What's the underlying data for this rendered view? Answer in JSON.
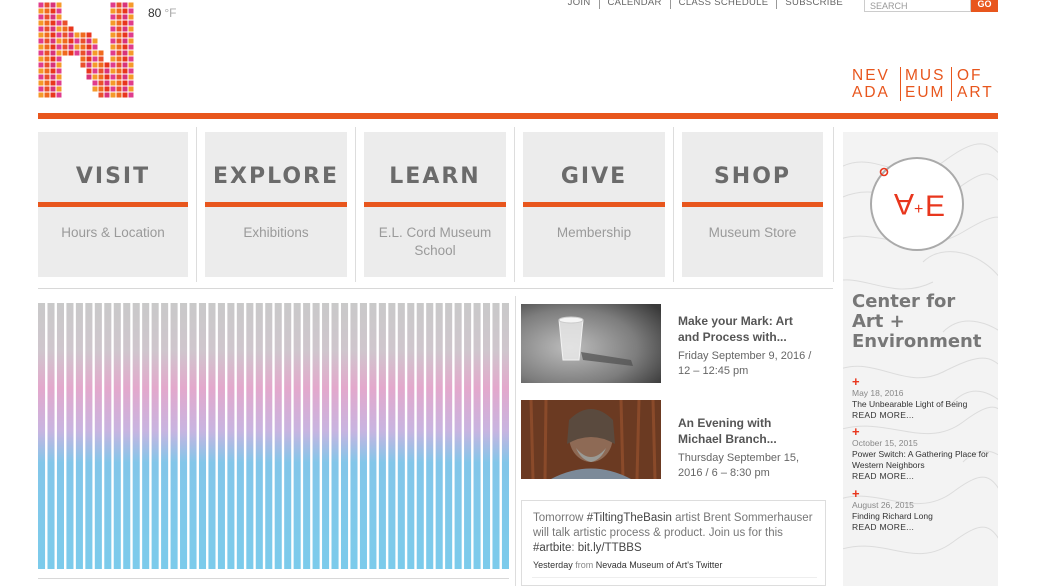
{
  "weather": {
    "temp": "80",
    "unit": "°F"
  },
  "top_nav": [
    "JOIN",
    "CALENDAR",
    "CLASS SCHEDULE",
    "SUBSCRIBE"
  ],
  "search": {
    "placeholder": "SEARCH",
    "button": "GO"
  },
  "wordmark": {
    "row1": [
      "NEV",
      "MUS",
      "OF"
    ],
    "row2": [
      "ADA",
      "EUM",
      "ART"
    ]
  },
  "tiles": [
    {
      "title": "VISIT",
      "subtitle": "Hours & Location"
    },
    {
      "title": "EXPLORE",
      "subtitle": "Exhibitions"
    },
    {
      "title": "LEARN",
      "subtitle": "E.L. Cord Museum School"
    },
    {
      "title": "GIVE",
      "subtitle": "Membership"
    },
    {
      "title": "SHOP",
      "subtitle": "Museum Store"
    }
  ],
  "events": [
    {
      "title": "Make your Mark: Art and Process with...",
      "date": "Friday September 9, 2016 / 12 – 12:45 pm"
    },
    {
      "title": "An Evening with Michael Branch...",
      "date": "Thursday September 15, 2016 / 6 – 8:30 pm"
    }
  ],
  "tweet": {
    "parts": [
      "Tomorrow ",
      "#TiltingTheBasin",
      " artist Brent Sommerhauser will talk artistic process & product. Join us for this ",
      "#artbite",
      ": ",
      "bit.ly/TTBBS"
    ],
    "when": "Yesterday",
    "from": "from",
    "account": "Nevada Museum of Art's Twitter"
  },
  "ae": {
    "logo_letters": [
      "A",
      "+",
      "E"
    ],
    "title": "Center for Art + Environment",
    "items": [
      {
        "date": "May 18, 2016",
        "title": "The Unbearable Light of Being",
        "more": "READ MORE..."
      },
      {
        "date": "October 15, 2015",
        "title": "Power Switch: A Gathering Place for Western Neighbors",
        "more": "READ MORE..."
      },
      {
        "date": "August 26, 2015",
        "title": "Finding Richard Long",
        "more": "READ MORE..."
      }
    ]
  },
  "colors": {
    "accent": "#e8561d",
    "tile_bg": "#ececec",
    "bar_blue": "#79cbea",
    "bar_pink": "#e8a3c8",
    "bar_grey": "#c8c8c8"
  }
}
